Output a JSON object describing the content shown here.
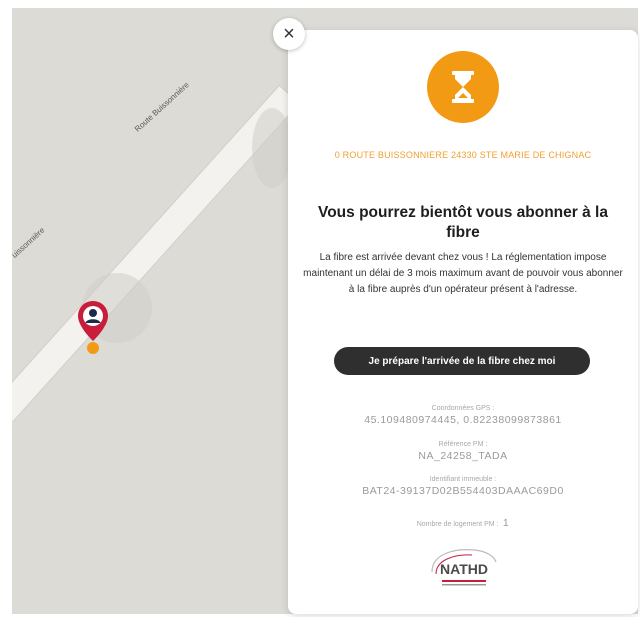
{
  "map": {
    "road_label_top": "Route Buissonnière",
    "road_label_bottom": "uissonnière"
  },
  "popup": {
    "close_label": "×",
    "address": "0 ROUTE BUISSONNIERE 24330 STE MARIE DE CHIGNAC",
    "title": "Vous pourrez bientôt vous abonner à la fibre",
    "description": "La fibre est arrivée devant chez vous ! La réglementation impose maintenant un délai de 3 mois maximum avant de pouvoir vous abonner à la fibre auprès d'un opérateur présent à l'adresse.",
    "cta_label": "Je prépare l'arrivée de la fibre chez moi",
    "gps_label": "Coordonnées GPS :",
    "gps_value": "45.109480974445, 0.82238099873861",
    "pm_label": "Référence PM :",
    "pm_value": "NA_24258_TADA",
    "building_label": "Identifiant immeuble :",
    "building_value": "BAT24-39137D02B554403DAAAC69D0",
    "logement_label": "Nombre de logement PM :",
    "logement_value": "1",
    "logo_text": "NATHD"
  },
  "colors": {
    "accent": "#f39a14",
    "pin": "#c81e3c",
    "button": "#2f2f2f"
  },
  "icons": {
    "status": "hourglass-icon",
    "marker": "location-pin-icon",
    "close": "close-icon"
  }
}
